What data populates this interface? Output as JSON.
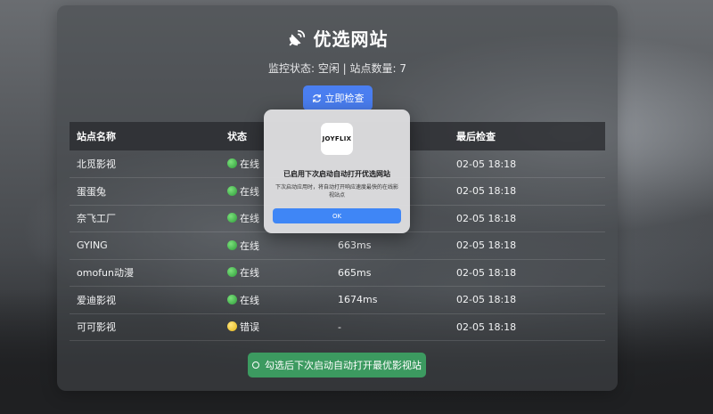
{
  "header": {
    "title": "优选网站",
    "status_text": "监控状态: 空闲 | 站点数量: 7",
    "check_button_label": "立即检查"
  },
  "table": {
    "columns": [
      "站点名称",
      "状态",
      "",
      "最后检查"
    ],
    "rows": [
      {
        "name": "北觅影视",
        "status": "在线",
        "status_color": "green",
        "latency": "",
        "last_check": "02-05 18:18"
      },
      {
        "name": "蛋蛋兔",
        "status": "在线",
        "status_color": "green",
        "latency": "",
        "last_check": "02-05 18:18"
      },
      {
        "name": "奈飞工厂",
        "status": "在线",
        "status_color": "green",
        "latency": "",
        "last_check": "02-05 18:18"
      },
      {
        "name": "GYING",
        "status": "在线",
        "status_color": "green",
        "latency": "663ms",
        "last_check": "02-05 18:18"
      },
      {
        "name": "omofun动漫",
        "status": "在线",
        "status_color": "green",
        "latency": "665ms",
        "last_check": "02-05 18:18"
      },
      {
        "name": "爱迪影视",
        "status": "在线",
        "status_color": "green",
        "latency": "1674ms",
        "last_check": "02-05 18:18"
      },
      {
        "name": "可可影视",
        "status": "错误",
        "status_color": "yellow",
        "latency": "-",
        "last_check": "02-05 18:18"
      }
    ]
  },
  "footer": {
    "autostart_label": "勾选后下次启动自动打开最优影视站"
  },
  "dialog": {
    "logo_text": "JOYFLIX",
    "title": "已启用下次启动自动打开优选网站",
    "body": "下次启动应用时，将自动打开响应速度最快的在线影视站点",
    "ok_label": "OK"
  },
  "colors": {
    "primary_blue": "#4a7ef0",
    "success_green": "#3c9a60",
    "online_dot": "#2e9d3a",
    "error_dot": "#e2b415"
  }
}
